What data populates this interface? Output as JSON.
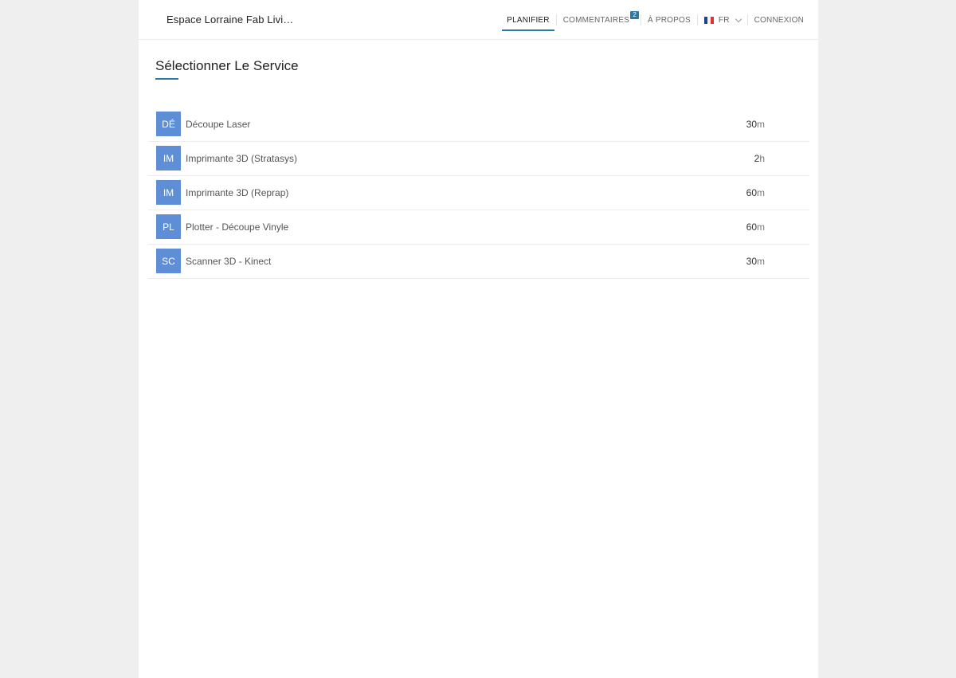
{
  "header": {
    "brand": "Espace Lorraine Fab Livi…",
    "nav": {
      "planifier": "PLANIFIER",
      "commentaires": "COMMENTAIRES",
      "commentaires_badge": "2",
      "apropos": "À PROPOS",
      "language": "FR",
      "connexion": "CONNEXION"
    }
  },
  "main": {
    "title": "Sélectionner Le Service",
    "services": [
      {
        "initials": "DÉ",
        "name": "Découpe Laser",
        "duration_value": "30",
        "duration_unit": "m"
      },
      {
        "initials": "IM",
        "name": "Imprimante 3D (Stratasys)",
        "duration_value": "2",
        "duration_unit": "h"
      },
      {
        "initials": "IM",
        "name": "Imprimante 3D (Reprap)",
        "duration_value": "60",
        "duration_unit": "m"
      },
      {
        "initials": "PL",
        "name": "Plotter - Découpe Vinyle",
        "duration_value": "60",
        "duration_unit": "m"
      },
      {
        "initials": "SC",
        "name": "Scanner 3D - Kinect",
        "duration_value": "30",
        "duration_unit": "m"
      }
    ]
  },
  "colors": {
    "accent": "#2b7aa6",
    "avatar": "#5e8fd6",
    "page_bg": "#efefef"
  },
  "icons": {
    "language_flag": "france-flag-icon",
    "language_dropdown": "chevron-down-icon"
  }
}
